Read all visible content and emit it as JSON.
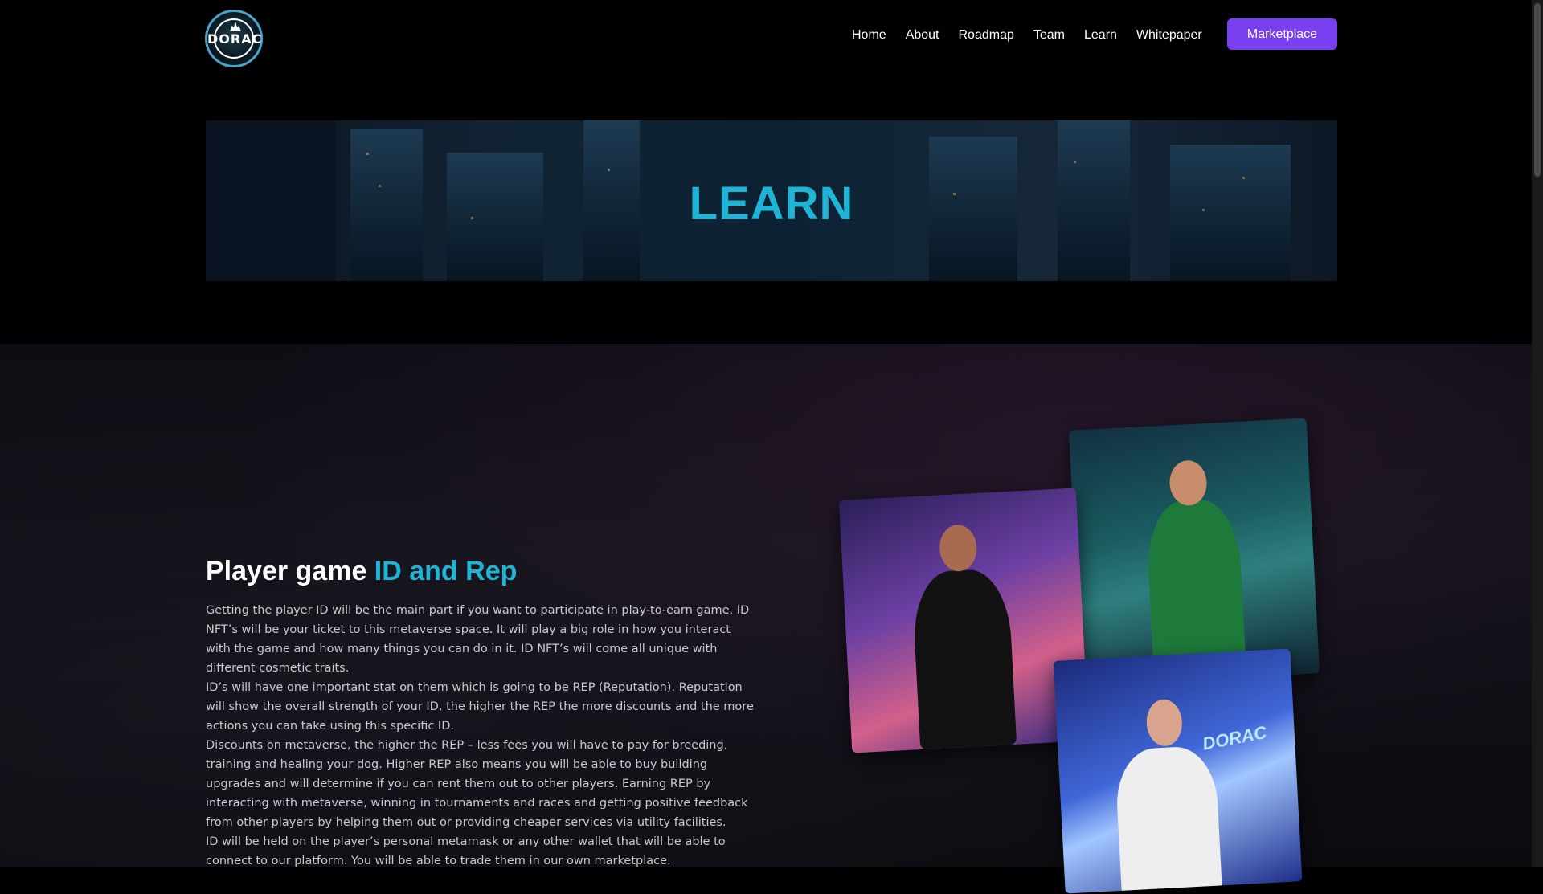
{
  "header": {
    "logo": {
      "text": "DORAC"
    },
    "nav": [
      "Home",
      "About",
      "Roadmap",
      "Team",
      "Learn",
      "Whitepaper"
    ],
    "cta_label": "Marketplace"
  },
  "banner": {
    "title": "LEARN"
  },
  "section": {
    "heading_prefix": "Player game ",
    "heading_highlight": "ID and Rep",
    "paragraphs": [
      "Getting the player ID will be the main part if you want to participate in play-to-earn game. ID NFT’s will be your ticket to this metaverse space. It will play a big role in how you interact with the game and how many things you can do in it. ID NFT’s will come all unique with different cosmetic traits.",
      "ID’s will have one important stat on them which is going to be REP (Reputation). Reputation will show the overall strength of your ID, the higher the REP the more discounts and the more actions you can take using this specific ID.",
      "Discounts on metaverse, the higher the REP – less fees you will have to pay for breeding, training and healing your dog. Higher REP also means you will be able to buy building upgrades and will determine if you can rent them out to other players. Earning REP by interacting with metaverse, winning in tournaments and races and getting positive feedback from other players by helping them out or providing cheaper services via utility facilities.",
      "ID will be held on the player’s personal metamask or any other wallet that will be able to connect to our platform. You will be able to trade them in our own marketplace."
    ],
    "card3_sign": "DORAC"
  },
  "colors": {
    "accent": "#1fb4d6",
    "button": "#7b3ff2",
    "background": "#000000"
  }
}
